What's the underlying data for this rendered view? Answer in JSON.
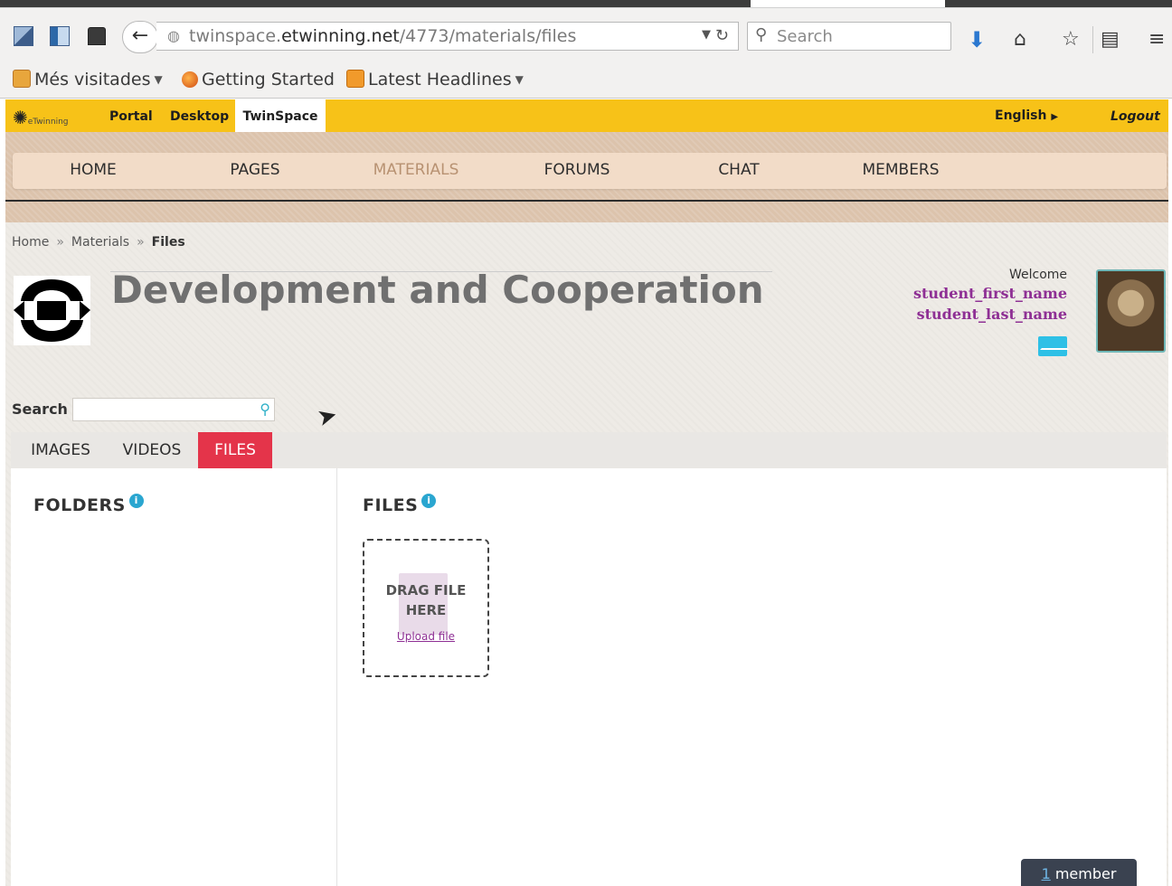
{
  "browser": {
    "url_prefix": "twinspace.",
    "url_domain": "etwinning.net",
    "url_path": "/4773/materials/files",
    "search_placeholder": "Search",
    "back_icon": "back-arrow-icon",
    "bookmarks": [
      {
        "label": "Més visitades",
        "icon": "folder-icon"
      },
      {
        "label": "Getting Started",
        "icon": "firefox-icon"
      },
      {
        "label": "Latest Headlines",
        "icon": "rss-icon"
      }
    ]
  },
  "site": {
    "logo_text": "eTwinning",
    "top_links": {
      "portal": "Portal",
      "desktop": "Desktop",
      "twinspace": "TwinSpace"
    },
    "language": "English",
    "logout": "Logout",
    "main_menu": [
      "HOME",
      "PAGES",
      "MATERIALS",
      "FORUMS",
      "CHAT",
      "MEMBERS"
    ],
    "active_menu": "MATERIALS",
    "breadcrumb": [
      "Home",
      "Materials",
      "Files"
    ],
    "project_title": "Development and Cooperation",
    "welcome": "Welcome",
    "user_first": "student_first_name",
    "user_last": "student_last_name",
    "search_label": "Search",
    "tabs": [
      "IMAGES",
      "VIDEOS",
      "FILES"
    ],
    "active_tab": "FILES",
    "folders_heading": "FOLDERS",
    "files_heading": "FILES",
    "drop_line1": "DRAG FILE",
    "drop_line2": "HERE",
    "upload_link": "Upload file",
    "online_count": "1",
    "online_text": " member online",
    "colors": {
      "yellow": "#f7c218",
      "active_tab": "#e4344a",
      "user_name": "#8e2f94",
      "menu_active": "#b89272"
    }
  }
}
